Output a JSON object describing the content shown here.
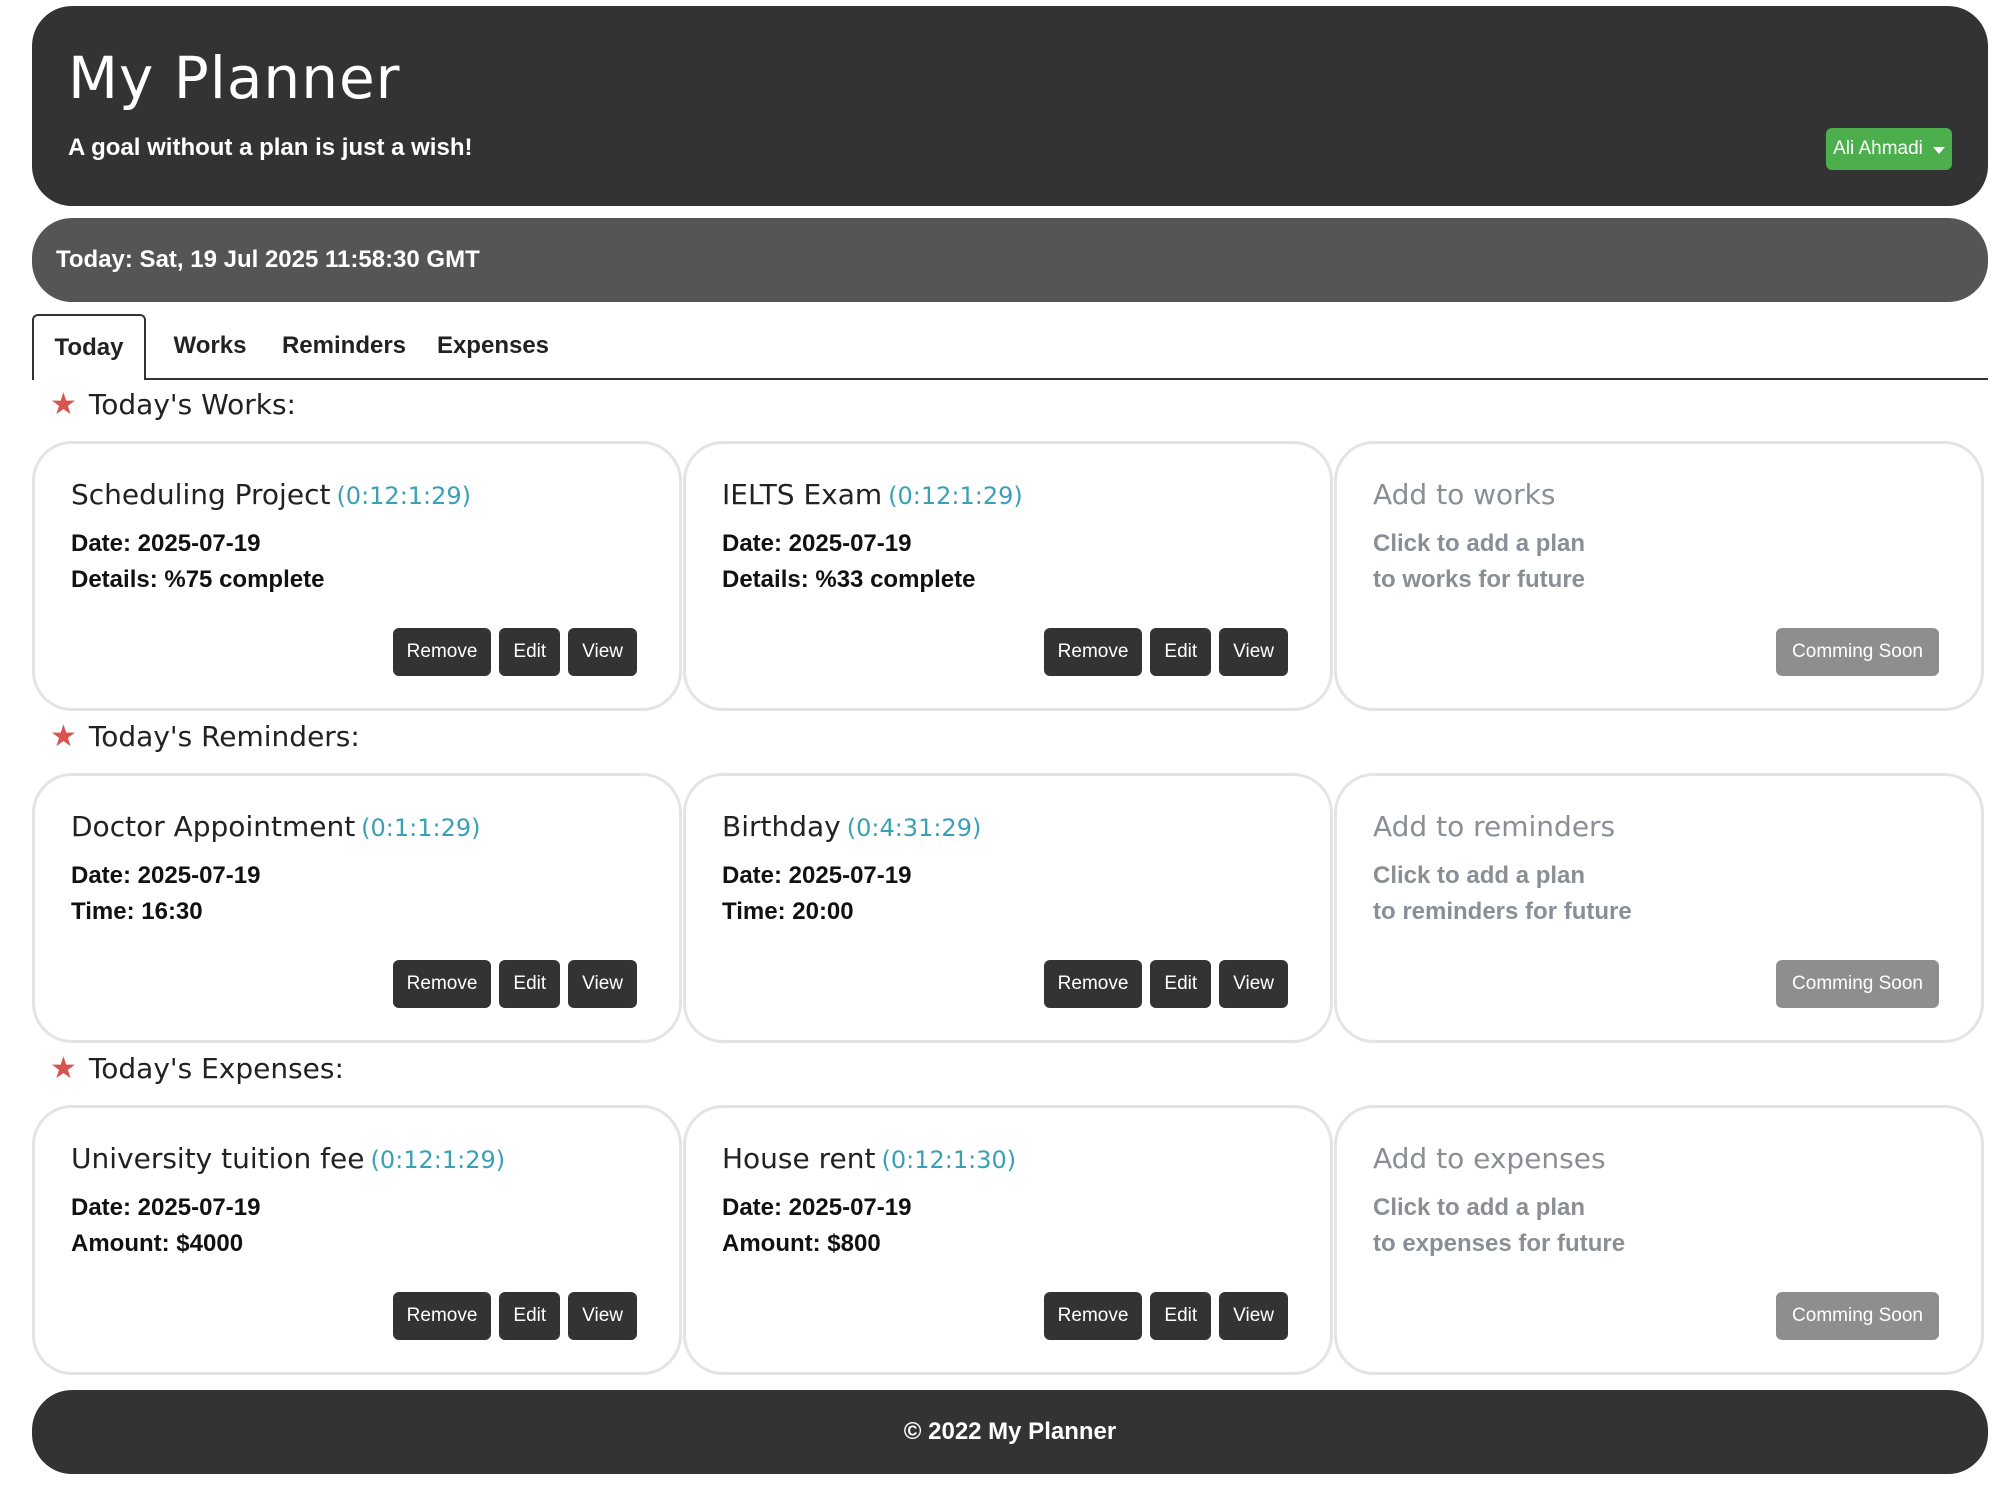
{
  "header": {
    "title": "My Planner",
    "tagline": "A goal without a plan is just a wish!",
    "user_button": "Ali Ahmadi"
  },
  "datebar": {
    "text": "Today: Sat, 19 Jul 2025 11:58:30 GMT"
  },
  "tabs": [
    {
      "label": "Today",
      "active": true
    },
    {
      "label": "Works",
      "active": false
    },
    {
      "label": "Reminders",
      "active": false
    },
    {
      "label": "Expenses",
      "active": false
    }
  ],
  "sections": {
    "works": {
      "title": "Today's Works:",
      "cards": [
        {
          "title": "Scheduling Project",
          "timer": "(0:12:1:29)",
          "line1": "Date: 2025-07-19",
          "line2": "Details: %75 complete"
        },
        {
          "title": "IELTS Exam",
          "timer": "(0:12:1:29)",
          "line1": "Date: 2025-07-19",
          "line2": "Details: %33 complete"
        }
      ],
      "add": {
        "title": "Add to works",
        "line1": "Click to add a plan",
        "line2": "to works for future",
        "button": "Comming Soon"
      }
    },
    "reminders": {
      "title": "Today's Reminders:",
      "cards": [
        {
          "title": "Doctor Appointment",
          "timer": "(0:1:1:29)",
          "line1": "Date: 2025-07-19",
          "line2": "Time: 16:30"
        },
        {
          "title": "Birthday",
          "timer": "(0:4:31:29)",
          "line1": "Date: 2025-07-19",
          "line2": "Time: 20:00"
        }
      ],
      "add": {
        "title": "Add to reminders",
        "line1": "Click to add a plan",
        "line2": "to reminders for future",
        "button": "Comming Soon"
      }
    },
    "expenses": {
      "title": "Today's Expenses:",
      "cards": [
        {
          "title": "University tuition fee",
          "timer": "(0:12:1:29)",
          "line1": "Date: 2025-07-19",
          "line2": "Amount: $4000"
        },
        {
          "title": "House rent",
          "timer": "(0:12:1:30)",
          "line1": "Date: 2025-07-19",
          "line2": "Amount: $800"
        }
      ],
      "add": {
        "title": "Add to expenses",
        "line1": "Click to add a plan",
        "line2": "to expenses for future",
        "button": "Comming Soon"
      }
    }
  },
  "card_buttons": {
    "remove": "Remove",
    "edit": "Edit",
    "view": "View"
  },
  "footer": {
    "text": "© 2022 My Planner"
  },
  "colors": {
    "header_bg": "#333333",
    "datebar_bg": "#555555",
    "user_button": "#4cae4c",
    "star": "#d9534f",
    "timer": "#3aa0b5",
    "muted": "#8a8f96"
  }
}
